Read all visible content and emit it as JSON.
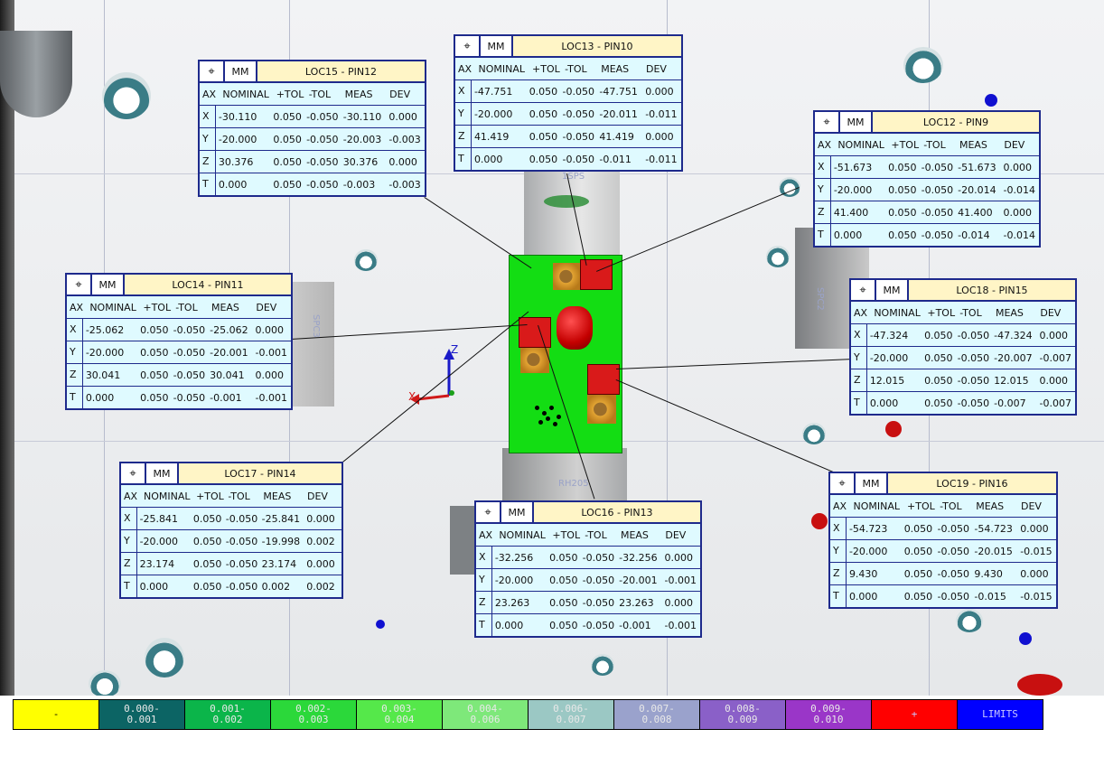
{
  "units_label": "MM",
  "position_symbol": "⌖",
  "columns": [
    "AX",
    "NOMINAL",
    "+TOL",
    "-TOL",
    "MEAS",
    "DEV"
  ],
  "callouts": [
    {
      "title": "LOC15 - PIN12",
      "rows": [
        [
          "X",
          "-30.110",
          "0.050",
          "-0.050",
          "-30.110",
          "0.000"
        ],
        [
          "Y",
          "-20.000",
          "0.050",
          "-0.050",
          "-20.003",
          "-0.003"
        ],
        [
          "Z",
          "30.376",
          "0.050",
          "-0.050",
          "30.376",
          "0.000"
        ],
        [
          "T",
          "0.000",
          "0.050",
          "-0.050",
          "-0.003",
          "-0.003"
        ]
      ]
    },
    {
      "title": "LOC13 - PIN10",
      "rows": [
        [
          "X",
          "-47.751",
          "0.050",
          "-0.050",
          "-47.751",
          "0.000"
        ],
        [
          "Y",
          "-20.000",
          "0.050",
          "-0.050",
          "-20.011",
          "-0.011"
        ],
        [
          "Z",
          "41.419",
          "0.050",
          "-0.050",
          "41.419",
          "0.000"
        ],
        [
          "T",
          "0.000",
          "0.050",
          "-0.050",
          "-0.011",
          "-0.011"
        ]
      ]
    },
    {
      "title": "LOC12 - PIN9",
      "rows": [
        [
          "X",
          "-51.673",
          "0.050",
          "-0.050",
          "-51.673",
          "0.000"
        ],
        [
          "Y",
          "-20.000",
          "0.050",
          "-0.050",
          "-20.014",
          "-0.014"
        ],
        [
          "Z",
          "41.400",
          "0.050",
          "-0.050",
          "41.400",
          "0.000"
        ],
        [
          "T",
          "0.000",
          "0.050",
          "-0.050",
          "-0.014",
          "-0.014"
        ]
      ]
    },
    {
      "title": "LOC14 - PIN11",
      "rows": [
        [
          "X",
          "-25.062",
          "0.050",
          "-0.050",
          "-25.062",
          "0.000"
        ],
        [
          "Y",
          "-20.000",
          "0.050",
          "-0.050",
          "-20.001",
          "-0.001"
        ],
        [
          "Z",
          "30.041",
          "0.050",
          "-0.050",
          "30.041",
          "0.000"
        ],
        [
          "T",
          "0.000",
          "0.050",
          "-0.050",
          "-0.001",
          "-0.001"
        ]
      ]
    },
    {
      "title": "LOC18 - PIN15",
      "rows": [
        [
          "X",
          "-47.324",
          "0.050",
          "-0.050",
          "-47.324",
          "0.000"
        ],
        [
          "Y",
          "-20.000",
          "0.050",
          "-0.050",
          "-20.007",
          "-0.007"
        ],
        [
          "Z",
          "12.015",
          "0.050",
          "-0.050",
          "12.015",
          "0.000"
        ],
        [
          "T",
          "0.000",
          "0.050",
          "-0.050",
          "-0.007",
          "-0.007"
        ]
      ]
    },
    {
      "title": "LOC17 - PIN14",
      "rows": [
        [
          "X",
          "-25.841",
          "0.050",
          "-0.050",
          "-25.841",
          "0.000"
        ],
        [
          "Y",
          "-20.000",
          "0.050",
          "-0.050",
          "-19.998",
          "0.002"
        ],
        [
          "Z",
          "23.174",
          "0.050",
          "-0.050",
          "23.174",
          "0.000"
        ],
        [
          "T",
          "0.000",
          "0.050",
          "-0.050",
          "0.002",
          "0.002"
        ]
      ]
    },
    {
      "title": "LOC16 - PIN13",
      "rows": [
        [
          "X",
          "-32.256",
          "0.050",
          "-0.050",
          "-32.256",
          "0.000"
        ],
        [
          "Y",
          "-20.000",
          "0.050",
          "-0.050",
          "-20.001",
          "-0.001"
        ],
        [
          "Z",
          "23.263",
          "0.050",
          "-0.050",
          "23.263",
          "0.000"
        ],
        [
          "T",
          "0.000",
          "0.050",
          "-0.050",
          "-0.001",
          "-0.001"
        ]
      ]
    },
    {
      "title": "LOC19 - PIN16",
      "rows": [
        [
          "X",
          "-54.723",
          "0.050",
          "-0.050",
          "-54.723",
          "0.000"
        ],
        [
          "Y",
          "-20.000",
          "0.050",
          "-0.050",
          "-20.015",
          "-0.015"
        ],
        [
          "Z",
          "9.430",
          "0.050",
          "-0.050",
          "9.430",
          "0.000"
        ],
        [
          "T",
          "0.000",
          "0.050",
          "-0.050",
          "-0.015",
          "-0.015"
        ]
      ]
    }
  ],
  "model_labels": {
    "block_top": "1SPS",
    "block_left": "SPC3",
    "block_right": "SPC2",
    "block_bottom": "RH205"
  },
  "axis_labels": {
    "x": "X",
    "z": "Z"
  },
  "legend": [
    {
      "label": "-",
      "color": "#ffff00"
    },
    {
      "label": "0.000-\n0.001",
      "color": "#0c6464"
    },
    {
      "label": "0.001-\n0.002",
      "color": "#0bb54a"
    },
    {
      "label": "0.002-\n0.003",
      "color": "#2bd83a"
    },
    {
      "label": "0.003-\n0.004",
      "color": "#55e84a"
    },
    {
      "label": "0.004-\n0.006",
      "color": "#7ee87a"
    },
    {
      "label": "0.006-\n0.007",
      "color": "#9bc8c4"
    },
    {
      "label": "0.007-\n0.008",
      "color": "#9aa2cc"
    },
    {
      "label": "0.008-\n0.009",
      "color": "#8a60c8"
    },
    {
      "label": "0.009-\n0.010",
      "color": "#9a36c8"
    },
    {
      "label": "+",
      "color": "#ff0000"
    },
    {
      "label": "LIMITS",
      "color": "#0000ff"
    }
  ]
}
